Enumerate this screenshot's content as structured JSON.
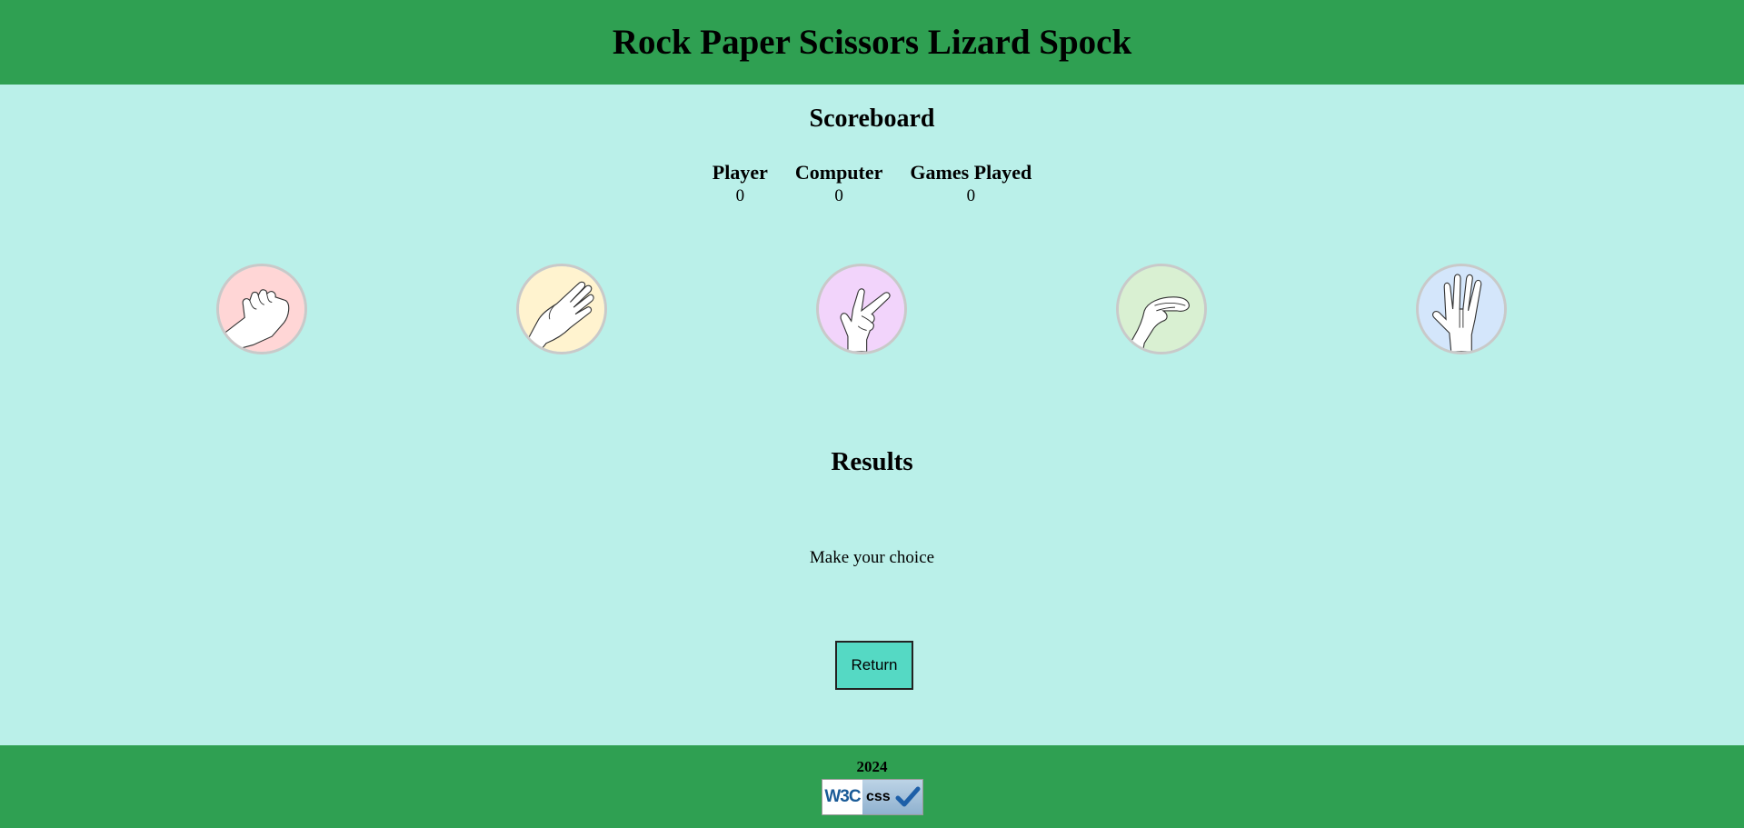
{
  "header": {
    "title": "Rock Paper Scissors Lizard Spock"
  },
  "scoreboard": {
    "title": "Scoreboard",
    "columns": [
      {
        "label": "Player",
        "value": "0"
      },
      {
        "label": "Computer",
        "value": "0"
      },
      {
        "label": "Games Played",
        "value": "0"
      }
    ]
  },
  "choices": [
    {
      "name": "rock",
      "bg": "#ffd6d6"
    },
    {
      "name": "paper",
      "bg": "#fff3cf"
    },
    {
      "name": "scissors",
      "bg": "#f2d4fb"
    },
    {
      "name": "lizard",
      "bg": "#d9f0d2"
    },
    {
      "name": "spock",
      "bg": "#d4e6fb"
    }
  ],
  "results": {
    "title": "Results",
    "message": "Make your choice"
  },
  "return_button": {
    "label": "Return"
  },
  "footer": {
    "year": "2024",
    "badge": {
      "left": "W3C",
      "right": "css",
      "icon": "checkmark-icon"
    }
  }
}
